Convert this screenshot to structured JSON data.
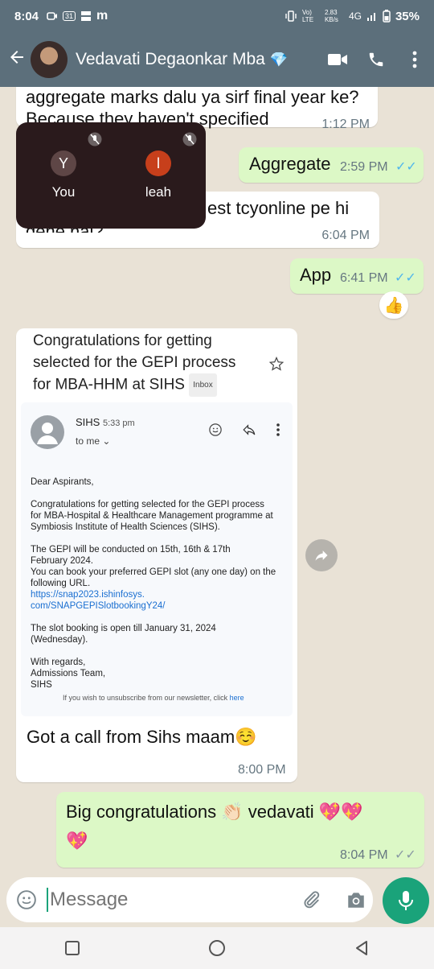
{
  "status": {
    "time": "8:04",
    "calendar_badge": "31",
    "app_letter": "m",
    "volte": "Vo) LTE",
    "speed": "2.83 KB/s",
    "network": "4G",
    "battery": "35%"
  },
  "header": {
    "contact_name": "Vedavati Degaonkar Mba",
    "icons": [
      "back-arrow-icon",
      "video-call-icon",
      "phone-icon",
      "more-vert-icon"
    ]
  },
  "messages": {
    "m1_text_line1": "aggregate marks dalu ya sirf final year ke?",
    "m1_text_line2": "Because they haven't specified",
    "m1_time": "1:12 PM",
    "m2_text": "Aggregate",
    "m2_time": "2:59 PM",
    "m3_text_line1": "est tcyonline pe hi",
    "m3_text_line2": "dene hai?",
    "m3_time": "6:04 PM",
    "m4_text": "App",
    "m4_time": "6:41 PM",
    "m4_reaction": "👍",
    "m5_caption": "Got a call from Sihs maam☺️",
    "m5_time": "8:00 PM",
    "m6_text_line1": "Big congratulations 👏🏻 vedavati 💖💖",
    "m6_text_line2": "💖",
    "m6_time": "8:04 PM"
  },
  "call": {
    "p1_initial": "Y",
    "p1_name": "You",
    "p2_initial": "l",
    "p2_name": "leah"
  },
  "email": {
    "subject_line1": "Congratulations for getting",
    "subject_line2": "selected for the GEPI process",
    "subject_line3": "for MBA-HHM at SIHS",
    "inbox_tag": "Inbox",
    "sender": "SIHS",
    "sent_time": "5:33 pm",
    "to": "to me",
    "greeting": "Dear Aspirants,",
    "para1_l1": "Congratulations for getting selected for the GEPI process",
    "para1_l2": "for MBA-Hospital & Healthcare Management programme at",
    "para1_l3": "Symbiosis Institute of Health Sciences (SIHS).",
    "para2_l1": "The GEPI will be conducted on 15th, 16th & 17th",
    "para2_l2": "February 2024.",
    "para2_l3": "You can book your preferred GEPI slot (any one day) on the",
    "para2_l4": "following URL.",
    "link_l1": "https://snap2023.ishinfosys.",
    "link_l2": "com/SNAPGEPISlotbookingY24/",
    "para3_l1": "The slot booking is open till January 31, 2024",
    "para3_l2": "(Wednesday).",
    "regards_l1": "With regards,",
    "regards_l2": "Admissions Team,",
    "regards_l3": "SIHS",
    "unsubscribe": "If you wish to unsubscribe from our newsletter, click",
    "unsubscribe_link": "here"
  },
  "input": {
    "placeholder": "Message"
  },
  "colors": {
    "header_bg": "#5c6f7b",
    "outgoing_bubble": "#dcf8c6",
    "incoming_bubble": "#ffffff",
    "mic_button": "#1aa37a",
    "read_ticks": "#4fb6ec"
  }
}
